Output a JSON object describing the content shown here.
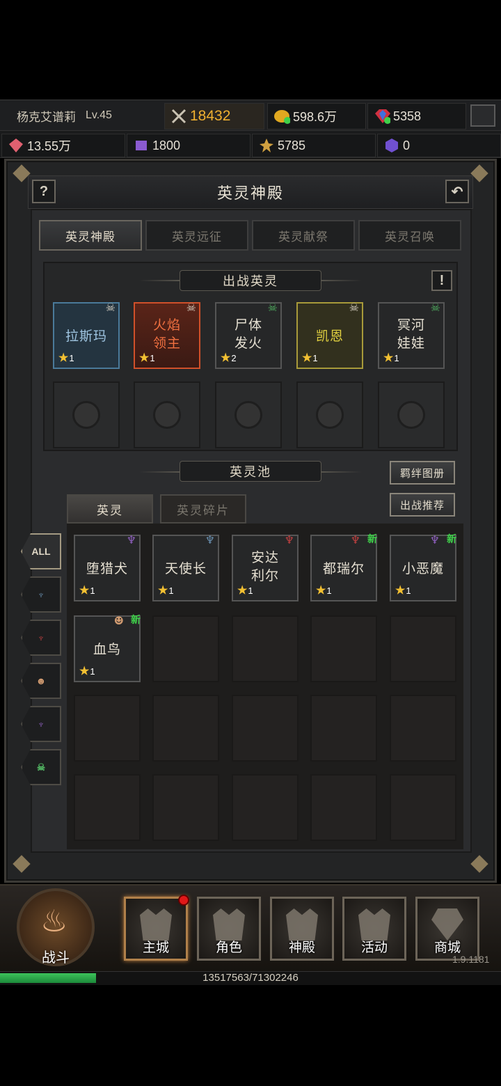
{
  "player": {
    "name": "杨克艾谱莉",
    "level": "Lv.45",
    "power": "18432",
    "gold": "598.6万",
    "gems": "5358"
  },
  "resources2": {
    "r1": "13.55万",
    "r2": "1800",
    "r3": "5785",
    "r4": "0"
  },
  "title": "英灵神殿",
  "tabs": [
    "英灵神殿",
    "英灵远征",
    "英灵献祭",
    "英灵召唤"
  ],
  "battle_section": {
    "title": "出战英灵",
    "heroes": [
      {
        "name": "拉斯玛",
        "stars": "1"
      },
      {
        "name": "火焰\n领主",
        "stars": "1"
      },
      {
        "name": "尸体\n发火",
        "stars": "2"
      },
      {
        "name": "凯恩",
        "stars": "1"
      },
      {
        "name": "冥河\n娃娃",
        "stars": "1"
      }
    ]
  },
  "pool": {
    "title": "英灵池",
    "btn_bond": "羁绊图册",
    "btn_recommend": "出战推荐",
    "subtab_hero": "英灵",
    "subtab_shard": "英灵碎片"
  },
  "filters": {
    "all": "ALL"
  },
  "pool_heroes": [
    {
      "name": "堕猎犬",
      "stars": "1",
      "new": ""
    },
    {
      "name": "天使长",
      "stars": "1",
      "new": ""
    },
    {
      "name": "安达\n利尔",
      "stars": "1",
      "new": ""
    },
    {
      "name": "都瑞尔",
      "stars": "1",
      "new": "新"
    },
    {
      "name": "小恶魔",
      "stars": "1",
      "new": "新"
    },
    {
      "name": "血鸟",
      "stars": "1",
      "new": "新"
    }
  ],
  "nav": {
    "fight": "战斗",
    "main": "主城",
    "role": "角色",
    "temple": "神殿",
    "activity": "活动",
    "shop": "商城"
  },
  "version": "1.9.1181",
  "exp": "13517563/71302246",
  "colors": {
    "border_blue": "#4a7a9a",
    "border_orange": "#d0502a",
    "border_gold": "#a89a3a",
    "star": "#f2c032",
    "new": "#3fd04a"
  }
}
